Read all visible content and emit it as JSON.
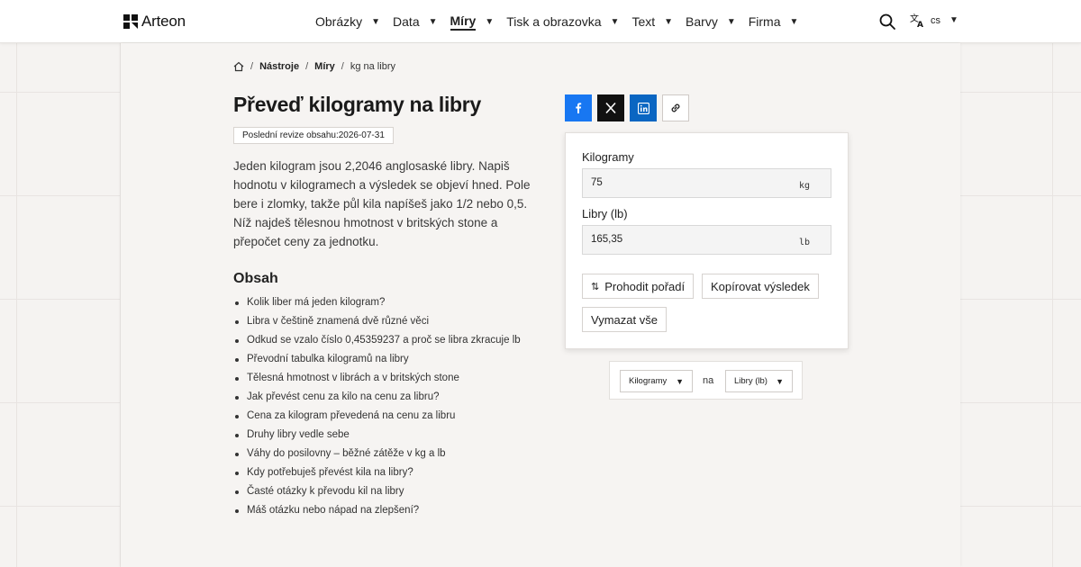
{
  "brand": {
    "name": "Arteon"
  },
  "nav": [
    {
      "label": "Obrázky"
    },
    {
      "label": "Data"
    },
    {
      "label": "Míry",
      "active": true
    },
    {
      "label": "Tisk a obrazovka"
    },
    {
      "label": "Text"
    },
    {
      "label": "Barvy"
    },
    {
      "label": "Firma"
    }
  ],
  "lang": {
    "code": "cs"
  },
  "breadcrumb": [
    "Nástroje",
    "Míry",
    "kg na libry"
  ],
  "page": {
    "title": "Převeď kilogramy na libry",
    "revision": "Poslední revize obsahu:2026-07-31",
    "intro": "Jeden kilogram jsou 2,2046 anglosaské libry. Napiš hodnotu v kilogramech a výsledek se objeví hned. Pole bere i zlomky, takže půl kila napíšeš jako 1/2 nebo 0,5. Níž najdeš tělesnou hmotnost v britských stone a přepočet ceny za jednotku."
  },
  "toc": {
    "title": "Obsah",
    "items": [
      "Kolik liber má jeden kilogram?",
      "Libra v češtině znamená dvě různé věci",
      "Odkud se vzalo číslo 0,45359237 a proč se libra zkracuje lb",
      "Převodní tabulka kilogramů na libry",
      "Tělesná hmotnost v librách a v britských stone",
      "Jak převést cenu za kilo na cenu za libru?",
      "Cena za kilogram převedená na cenu za libru",
      "Druhy libry vedle sebe",
      "Váhy do posilovny – běžné zátěže v kg a lb",
      "Kdy potřebuješ převést kila na libry?",
      "Časté otázky k převodu kil na libry",
      "Máš otázku nebo nápad na zlepšení?"
    ]
  },
  "converter": {
    "from_label": "Kilogramy",
    "from_value": "75",
    "from_unit": "kg",
    "to_label": "Libry (lb)",
    "to_value": "165,35",
    "to_unit": "lb",
    "swap_label": "Prohodit pořadí",
    "copy_label": "Kopírovat výsledek",
    "clear_label": "Vymazat vše"
  },
  "unit_switch": {
    "from": "Kilogramy",
    "joiner": "na",
    "to": "Libry (lb)"
  },
  "colors": {
    "facebook": "#1877f2",
    "x": "#111111",
    "linkedin": "#0a66c2"
  }
}
